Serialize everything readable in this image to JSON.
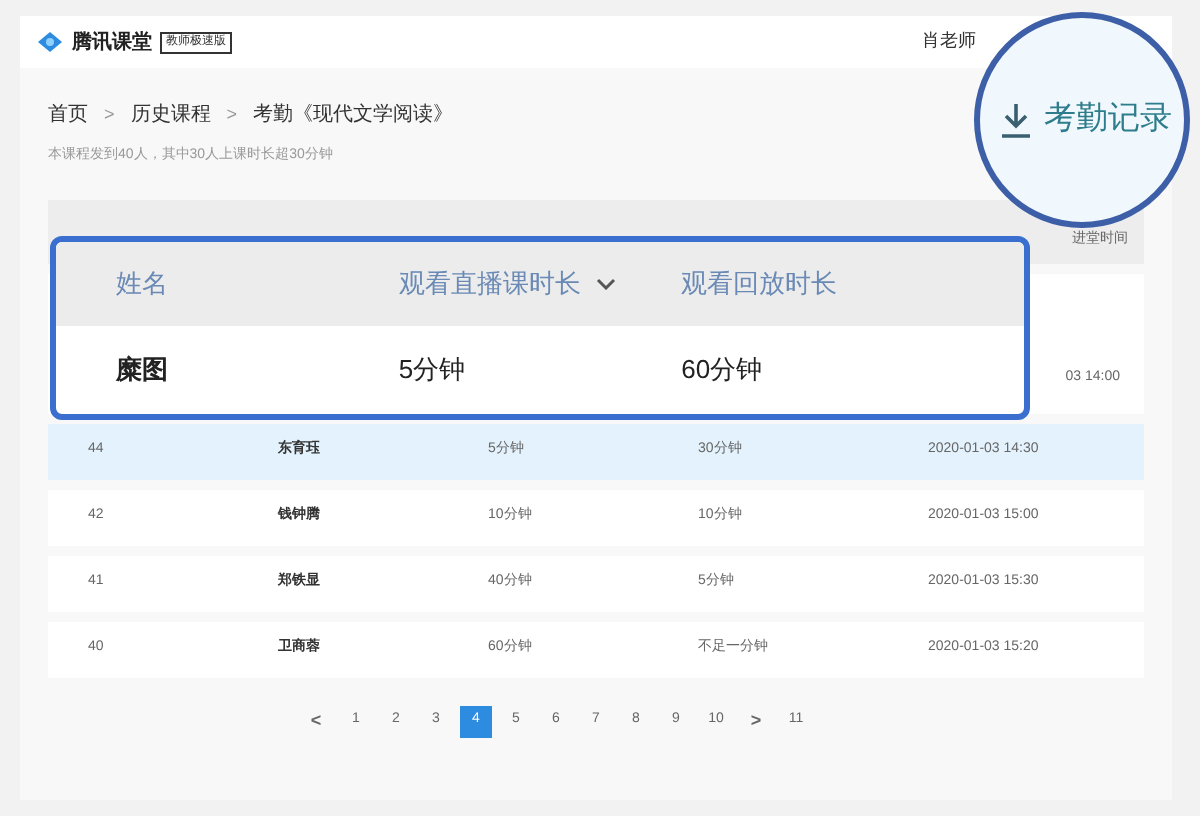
{
  "header": {
    "brand": "腾讯课堂",
    "badge": "教师极速版",
    "user": "肖老师"
  },
  "breadcrumb": [
    {
      "label": "首页"
    },
    {
      "separator": ">",
      "label": "历史课程"
    },
    {
      "separator": ">",
      "label": "考勤《现代文学阅读》"
    }
  ],
  "summary": "本课程发到40人，其中30人上课时长超30分钟",
  "export_callout": {
    "label": "考勤记录"
  },
  "table": {
    "columns_visible": [
      "进堂时间"
    ],
    "partial_row": "03 14:00",
    "rows": [
      {
        "id": "44",
        "name": "东育珏",
        "live": "5分钟",
        "replay": "30分钟",
        "time": "2020-01-03 14:30",
        "selected": true
      },
      {
        "id": "42",
        "name": "钱钟腾",
        "live": "10分钟",
        "replay": "10分钟",
        "time": "2020-01-03 15:00",
        "selected": false
      },
      {
        "id": "41",
        "name": "郑铁显",
        "live": "40分钟",
        "replay": "5分钟",
        "time": "2020-01-03 15:30",
        "selected": false
      },
      {
        "id": "40",
        "name": "卫商蓉",
        "live": "60分钟",
        "replay": "不足一分钟",
        "time": "2020-01-03 15:20",
        "selected": false
      }
    ]
  },
  "zoom_callout": {
    "columns": [
      "姓名",
      "观看直播课时长",
      "观看回放时长"
    ],
    "row": [
      "糜图",
      "5分钟",
      "60分钟"
    ]
  },
  "pagination": [
    {
      "kind": "prev",
      "label": "<",
      "selected": false
    },
    {
      "kind": "page",
      "label": "1",
      "selected": false
    },
    {
      "kind": "page",
      "label": "2",
      "selected": false
    },
    {
      "kind": "page",
      "label": "3",
      "selected": false
    },
    {
      "kind": "page",
      "label": "4",
      "selected": true
    },
    {
      "kind": "page",
      "label": "5",
      "selected": false
    },
    {
      "kind": "page",
      "label": "6",
      "selected": false
    },
    {
      "kind": "page",
      "label": "7",
      "selected": false
    },
    {
      "kind": "page",
      "label": "8",
      "selected": false
    },
    {
      "kind": "page",
      "label": "9",
      "selected": false
    },
    {
      "kind": "page",
      "label": "10",
      "selected": false
    },
    {
      "kind": "next",
      "label": ">",
      "selected": false
    },
    {
      "kind": "page",
      "label": "11",
      "selected": false
    }
  ]
}
